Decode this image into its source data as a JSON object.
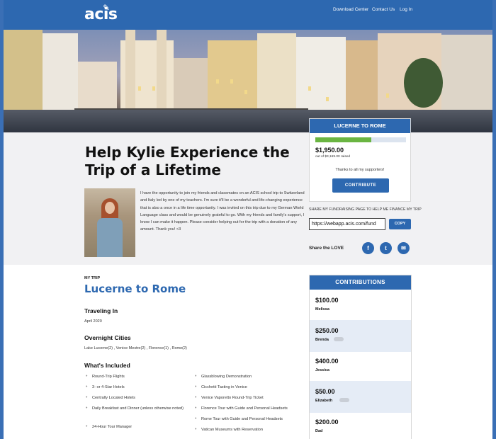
{
  "header": {
    "logo": "acis",
    "nav": [
      "Download Center",
      "Contact Us",
      "Log In"
    ]
  },
  "intro": {
    "title": "Help Kylie Experience the Trip of a Lifetime",
    "bio": "I have the opportunity to join my friends and classmates on an ACIS school trip to Switzerland and Italy led by one of my teachers. I'm sure it'll be a wonderful and life-changing experience that is also a once in a life time opportunity. I was invited on this trip due to my German World Language class and would be genuinely grateful to go. With my friends and family's support, I know I can make it happen. Please consider helping out for the trip with a donation of any amount. Thank you! <3"
  },
  "fundraiser": {
    "trip_label": "LUCERNE TO ROME",
    "amount": "$1,950.00",
    "goal_text": "out of $3,169.00 raised",
    "progress_fraction": 0.62,
    "thanks": "Thanks to all my supporters!",
    "contribute_label": "CONTRIBUTE"
  },
  "share": {
    "caption": "SHARE MY FUNDRAISING PAGE TO HELP ME FINANCE MY TRIP",
    "url": "https://webapp.acis.com/fund",
    "copy_label": "COPY",
    "love_label": "Share the LOVE",
    "icons": [
      "facebook-icon",
      "twitter-icon",
      "email-icon"
    ]
  },
  "trip": {
    "eyebrow": "MY TRIP",
    "name": "Lucerne to Rome",
    "traveling_heading": "Traveling In",
    "traveling_value": "April 2020",
    "cities_heading": "Overnight Cities",
    "cities_value": "Lake Lucerne(2) , Venice Mestre(2) , Florence(1) , Rome(2)",
    "included_heading": "What's Included",
    "included_left": [
      "Round-Trip Flights",
      "3- or 4-Star Hotels",
      "Centrally Located Hotels",
      "Daily Breakfast and Dinner (unless otherwise noted)",
      "24-Hour Tour Manager"
    ],
    "included_right": [
      "Glassblowing Demonstration",
      "Cicchetti Tasting in Venice",
      "Venice Vaporetto Round-Trip Ticket",
      "Florence Tour with Guide and Personal Headsets",
      "Rome Tour with Guide and Personal Headsets",
      "Vatican Museums with Reservation"
    ]
  },
  "contributions": {
    "heading": "CONTRIBUTIONS",
    "items": [
      {
        "amount": "$100.00",
        "name": "Melissa"
      },
      {
        "amount": "$250.00",
        "name": "Brenda"
      },
      {
        "amount": "$400.00",
        "name": "Jessica"
      },
      {
        "amount": "$50.00",
        "name": "Elizabeth"
      },
      {
        "amount": "$200.00",
        "name": "Dad"
      }
    ]
  }
}
